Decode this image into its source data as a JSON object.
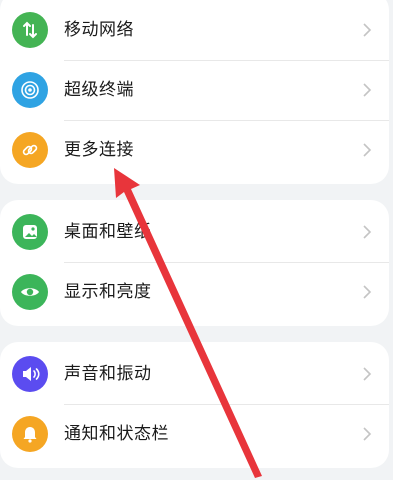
{
  "groups": [
    {
      "items": [
        {
          "label": "移动网络",
          "icon": "mobile-network-icon",
          "color": "#44b454"
        },
        {
          "label": "超级终端",
          "icon": "super-device-icon",
          "color": "#2fa3e3"
        },
        {
          "label": "更多连接",
          "icon": "link-icon",
          "color": "#f5a623"
        }
      ]
    },
    {
      "items": [
        {
          "label": "桌面和壁纸",
          "icon": "wallpaper-icon",
          "color": "#3cb55a"
        },
        {
          "label": "显示和亮度",
          "icon": "eye-icon",
          "color": "#3cb55a"
        }
      ]
    },
    {
      "items": [
        {
          "label": "声音和振动",
          "icon": "speaker-icon",
          "color": "#5b4cf0"
        },
        {
          "label": "通知和状态栏",
          "icon": "bell-icon",
          "color": "#f5a623"
        }
      ]
    }
  ],
  "annotation": {
    "type": "red-arrow",
    "color": "#e8353b"
  }
}
